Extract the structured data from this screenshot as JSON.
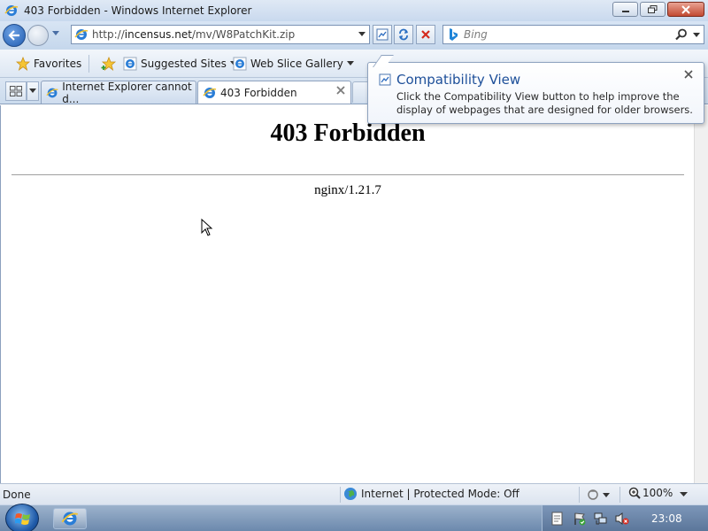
{
  "window": {
    "title": "403 Forbidden - Windows Internet Explorer"
  },
  "navigation": {
    "address_prefix": "http://",
    "address_domain": "incensus.net",
    "address_path": "/mv/W8PatchKit.zip",
    "search_placeholder": "Bing"
  },
  "favorites_bar": {
    "favorites_label": "Favorites",
    "suggested_sites_label": "Suggested Sites",
    "web_slice_gallery_label": "Web Slice Gallery"
  },
  "tabs": [
    {
      "label": "Internet Explorer cannot d...",
      "active": false
    },
    {
      "label": "403 Forbidden",
      "active": true
    }
  ],
  "page": {
    "heading": "403 Forbidden",
    "server": "nginx/1.21.7"
  },
  "compat_popup": {
    "title": "Compatibility View",
    "body": "Click the Compatibility View button to help improve the display of webpages that are designed for older browsers."
  },
  "status_bar": {
    "status": "Done",
    "zone": "Internet | Protected Mode: Off",
    "zoom": "100%"
  },
  "taskbar": {
    "clock": "23:08"
  },
  "colors": {
    "popup_title": "#1d4f99",
    "close_button": "#c24a32",
    "accent_blue": "#1f5bb0"
  }
}
